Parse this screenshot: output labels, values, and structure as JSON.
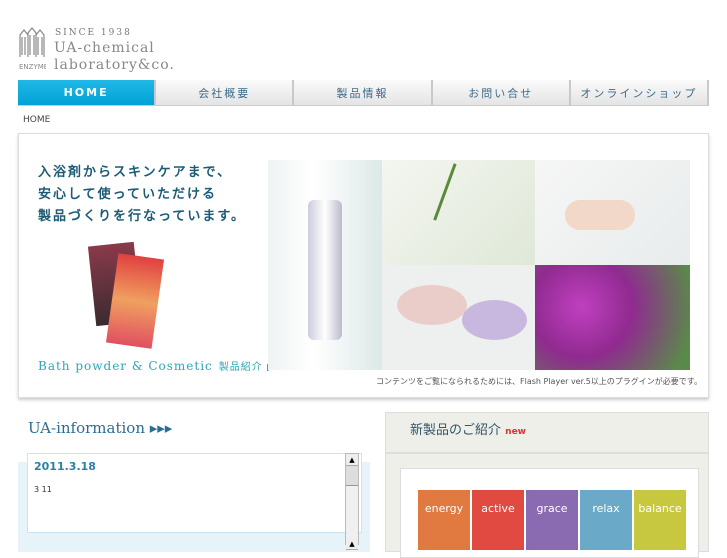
{
  "logo": {
    "since": "SINCE 1938",
    "name_line1": "UA-chemical",
    "name_line2": "laboratory&co.",
    "mark_text": "ENZYME"
  },
  "nav": [
    "HOME",
    "会社概要",
    "製品情報",
    "お問い合せ",
    "オンラインショップ"
  ],
  "breadcrumb": "HOME",
  "hero": {
    "catch": [
      "入浴剤からスキンケアまで、",
      "安心して使っていただける",
      "製品づくりを行なっています。"
    ],
    "bath_link": "Bath powder & Cosmetic",
    "bath_link_sub": "製品紹介 ▶",
    "flash_note": "コンテンツをご覧になられるためには、Flash Player ver.5以上のプラグインが必要です。"
  },
  "info": {
    "title": "UA-information ▸▸▸",
    "date": "2011.3.18",
    "text": "3 11"
  },
  "new_products": {
    "title": "新製品のご紹介",
    "badge": "new",
    "items": [
      {
        "name": "energy",
        "color": "#e07a40"
      },
      {
        "name": "active",
        "color": "#e04a40"
      },
      {
        "name": "grace",
        "color": "#8a6ab0"
      },
      {
        "name": "relax",
        "color": "#6aaac8"
      },
      {
        "name": "balance",
        "color": "#c8c840"
      }
    ]
  }
}
